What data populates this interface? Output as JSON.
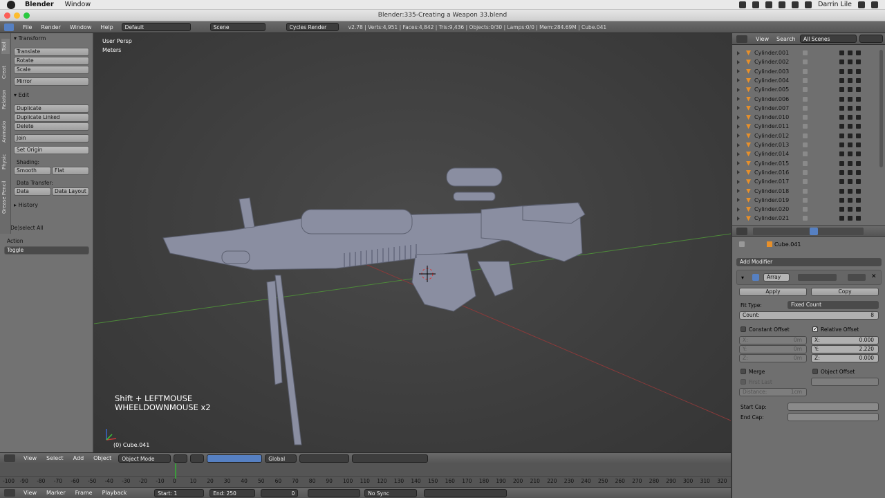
{
  "mac": {
    "app": "Blender",
    "menu": [
      "Window"
    ],
    "user": "Darrin Lile"
  },
  "window_title": "Blender:335-Creating a Weapon 33.blend",
  "info_header": {
    "menus": [
      "File",
      "Render",
      "Window",
      "Help"
    ],
    "layout": "Default",
    "scene": "Scene",
    "engine": "Cycles Render",
    "stats": "v2.78 | Verts:4,951 | Faces:4,842 | Tris:9,436 | Objects:0/30 | Lamps:0/0 | Mem:284.69M | Cube.041"
  },
  "toolshelf": {
    "tabs": [
      "Tool",
      "Creat",
      "Relation",
      "Animatio",
      "Physic",
      "Grease Pencil"
    ],
    "transform_header": "Transform",
    "transform_buttons": [
      "Translate",
      "Rotate",
      "Scale",
      "Mirror"
    ],
    "edit_header": "Edit",
    "edit_buttons": [
      "Duplicate",
      "Duplicate Linked",
      "Delete",
      "Join"
    ],
    "set_origin": "Set Origin",
    "shading_label": "Shading:",
    "smooth": "Smooth",
    "flat": "Flat",
    "data_transfer_label": "Data Transfer:",
    "data": "Data",
    "data_layout": "Data Layout",
    "history_header": "History",
    "operator_header": "(De)select All",
    "action_label": "Action",
    "action_value": "Toggle"
  },
  "viewport": {
    "view_name": "User Persp",
    "units": "Meters",
    "key_hint_1": "Shift + LEFTMOUSE",
    "key_hint_2": "WHEELDOWNMOUSE x2",
    "active_object": "(0) Cube.041"
  },
  "viewport_header": {
    "menus": [
      "View",
      "Select",
      "Add",
      "Object"
    ],
    "mode": "Object Mode",
    "orientation": "Global"
  },
  "outliner": {
    "menus": [
      "View",
      "Search"
    ],
    "filter": "All Scenes",
    "items": [
      "Cylinder.001",
      "Cylinder.002",
      "Cylinder.003",
      "Cylinder.004",
      "Cylinder.005",
      "Cylinder.006",
      "Cylinder.007",
      "Cylinder.010",
      "Cylinder.011",
      "Cylinder.012",
      "Cylinder.013",
      "Cylinder.014",
      "Cylinder.015",
      "Cylinder.016",
      "Cylinder.017",
      "Cylinder.018",
      "Cylinder.019",
      "Cylinder.020",
      "Cylinder.021"
    ]
  },
  "properties": {
    "object": "Cube.041",
    "add_modifier": "Add Modifier",
    "modifier_name": "Array",
    "apply": "Apply",
    "copy": "Copy",
    "fit_type_label": "Fit Type:",
    "fit_type": "Fixed Count",
    "count_label": "Count:",
    "count": "8",
    "constant_offset": "Constant Offset",
    "relative_offset": "Relative Offset",
    "const_labels": [
      "X:",
      "Y:",
      "Z:"
    ],
    "const_values": [
      "0m",
      "0m",
      "0m"
    ],
    "rel_labels": [
      "X:",
      "Y:",
      "Z:"
    ],
    "rel_values": [
      "0.000",
      "2.220",
      "0.000"
    ],
    "merge": "Merge",
    "object_offset": "Object Offset",
    "first_last": "First Last",
    "distance_label": "Distance:",
    "distance": "1cm",
    "start_cap": "Start Cap:",
    "end_cap": "End Cap:"
  },
  "timeline": {
    "ticks": [
      "-100",
      "-90",
      "-80",
      "-70",
      "-60",
      "-50",
      "-40",
      "-30",
      "-20",
      "-10",
      "0",
      "10",
      "20",
      "30",
      "40",
      "50",
      "60",
      "70",
      "80",
      "90",
      "100",
      "110",
      "120",
      "130",
      "140",
      "150",
      "160",
      "170",
      "180",
      "190",
      "200",
      "210",
      "220",
      "230",
      "240",
      "250",
      "260",
      "270",
      "280",
      "290",
      "300",
      "310",
      "320"
    ],
    "menus": [
      "View",
      "Marker",
      "Frame",
      "Playback"
    ],
    "start_label": "Start:",
    "start": "1",
    "end_label": "End:",
    "end": "250",
    "current": "0",
    "sync": "No Sync"
  },
  "colors": {
    "mesh_icon": "#e8902a",
    "selected": "#5680c2",
    "grid_x": "#8a3a3a",
    "grid_y": "#4e8a3a"
  }
}
